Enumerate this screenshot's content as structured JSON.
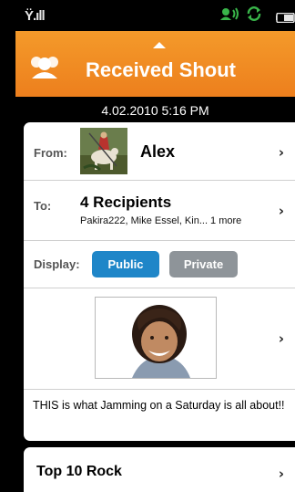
{
  "status": {
    "signal": "Ÿ.ıll"
  },
  "header": {
    "title": "Received Shout"
  },
  "date": "4.02.2010 5:16 PM",
  "from": {
    "label": "From:",
    "name": "Alex"
  },
  "to": {
    "label": "To:",
    "count": "4 Recipients",
    "names": "Pakira222, Mike Essel, Kin... 1 more"
  },
  "display": {
    "label": "Display:",
    "public": "Public",
    "private": "Private"
  },
  "message": "THIS is what Jamming on a Saturday is all about!!",
  "next_card": {
    "title": "Top 10 Rock"
  },
  "colors": {
    "accent": "#f08a22",
    "public": "#1f86c8",
    "private": "#8e9499"
  },
  "icons": {
    "chevron": "›"
  }
}
